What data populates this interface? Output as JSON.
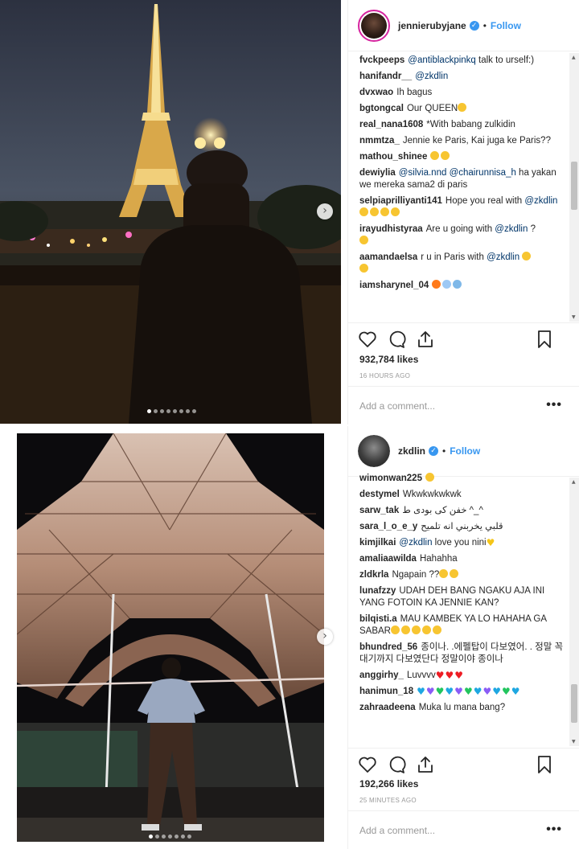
{
  "post1": {
    "username": "jennierubyjane",
    "follow_label": "Follow",
    "bullet": "•",
    "comments": [
      {
        "user": "fvckpeeps",
        "parts": [
          {
            "t": "@antiblackpinkq",
            "m": true
          },
          {
            "t": " talk to urself:)"
          }
        ]
      },
      {
        "user": "hanifandr__",
        "parts": [
          {
            "t": "@zkdlin",
            "m": true
          }
        ]
      },
      {
        "user": "dvxwao",
        "parts": [
          {
            "t": "Ih bagus"
          }
        ]
      },
      {
        "user": "bgtongcal",
        "parts": [
          {
            "t": "Our QUEEN"
          }
        ],
        "emoji": [
          "heart-eyes"
        ]
      },
      {
        "user": "real_nana1608",
        "parts": [
          {
            "t": "*With babang zulkidin"
          }
        ]
      },
      {
        "user": "nmmtza_",
        "parts": [
          {
            "t": "Jennie ke Paris, Kai juga ke Paris??"
          }
        ]
      },
      {
        "user": "mathou_shinee",
        "parts": [],
        "emoji": [
          "heart-eyes",
          "heart-eyes"
        ]
      },
      {
        "user": "dewiylia",
        "parts": [
          {
            "t": "@silvia.nnd",
            "m": true
          },
          {
            "t": " "
          },
          {
            "t": "@chairunnisa_h",
            "m": true
          },
          {
            "t": " ha yakan we mereka sama2 di paris"
          }
        ]
      },
      {
        "user": "selpiaprilliyanti141",
        "parts": [
          {
            "t": "Hope you real with "
          },
          {
            "t": "@zkdlin",
            "m": true
          },
          {
            "t": " "
          }
        ],
        "emoji": [
          "grin",
          "pray",
          "pray",
          "pray"
        ]
      },
      {
        "user": "irayudhistyraa",
        "parts": [
          {
            "t": "Are u going with "
          },
          {
            "t": "@zkdlin",
            "m": true
          },
          {
            "t": " ?"
          }
        ],
        "emoji_newline": [
          "grimace"
        ]
      },
      {
        "user": "aamandaelsa",
        "parts": [
          {
            "t": "r u in Paris with "
          },
          {
            "t": "@zkdlin",
            "m": true
          },
          {
            "t": " "
          }
        ],
        "emoji": [
          "grin"
        ],
        "emoji_newline": [
          "grin"
        ]
      },
      {
        "user": "iamsharynel_04",
        "parts": [],
        "emoji": [
          "fire",
          "scream",
          "cry"
        ]
      }
    ],
    "likes": "932,784 likes",
    "timeago": "16 HOURS AGO",
    "add_comment_placeholder": "Add a comment...",
    "more": "•••"
  },
  "post2": {
    "username": "zkdlin",
    "follow_label": "Follow",
    "bullet": "•",
    "comments": [
      {
        "user": "wimonwan225",
        "parts": [],
        "emoji": [
          "grin"
        ],
        "partial": true
      },
      {
        "user": "destymel",
        "parts": [
          {
            "t": "Wkwkwkwkwk"
          }
        ]
      },
      {
        "user": "sarw_tak",
        "parts": [
          {
            "t": "خفن کی بودی ط ^_^"
          }
        ]
      },
      {
        "user": "sara_l_o_e_y",
        "parts": [
          {
            "t": "قلبي يخربني انه تلميح"
          }
        ]
      },
      {
        "user": "kimjilkai",
        "parts": [
          {
            "t": "@zkdlin",
            "m": true
          },
          {
            "t": " love you nini"
          }
        ],
        "hearts": [
          "yellow"
        ]
      },
      {
        "user": "amaliaawilda",
        "parts": [
          {
            "t": "Hahahha"
          }
        ]
      },
      {
        "user": "zldkrla",
        "parts": [
          {
            "t": "Ngapain ??"
          }
        ],
        "emoji": [
          "tired",
          "tired"
        ]
      },
      {
        "user": "lunafzzy",
        "parts": [
          {
            "t": "UDAH DEH BANG NGAKU AJA INI YANG FOTOIN KA JENNIE KAN?"
          }
        ]
      },
      {
        "user": "bilqisti.a",
        "parts": [
          {
            "t": "MAU KAMBEK YA LO HAHAHA GA SABAR"
          }
        ],
        "emoji": [
          "open",
          "open",
          "open",
          "open",
          "open"
        ]
      },
      {
        "user": "bhundred_56",
        "parts": [
          {
            "t": "종이나. .에펠탑이 다보였어. . 정말 꼭대기까지 다보였단다 정말이야 종이나"
          }
        ]
      },
      {
        "user": "anggirhy_",
        "parts": [
          {
            "t": "Luvvvv"
          }
        ],
        "hearts": [
          "red",
          "red",
          "red"
        ]
      },
      {
        "user": "hanimun_18",
        "parts": [],
        "hearts": [
          "blue",
          "purple",
          "green",
          "blue",
          "purple",
          "green",
          "blue",
          "purple",
          "blue",
          "green",
          "blue"
        ]
      },
      {
        "user": "zahraadeena",
        "parts": [
          {
            "t": "Muka lu mana bang?"
          }
        ],
        "partial": true
      }
    ],
    "likes": "192,266 likes",
    "timeago": "25 MINUTES AGO",
    "add_comment_placeholder": "Add a comment...",
    "more": "•••"
  },
  "colors": {
    "accent": "#3897f0",
    "mention": "#003569",
    "muted": "#999999",
    "border": "#efefef",
    "story_ring": "#d6249f",
    "heart_red": "#ed1c24",
    "heart_yellow": "#f5c518",
    "heart_green": "#22c55e",
    "heart_blue": "#1ea7e1",
    "heart_purple": "#8b5cf6",
    "emoji_yellow": "#f7c531"
  },
  "icons": [
    "verified-badge-icon",
    "heart-outline-icon",
    "comment-icon",
    "share-icon",
    "bookmark-icon",
    "more-options-icon",
    "next-photo-arrow-icon",
    "scroll-up-arrow-icon",
    "scroll-down-arrow-icon"
  ]
}
